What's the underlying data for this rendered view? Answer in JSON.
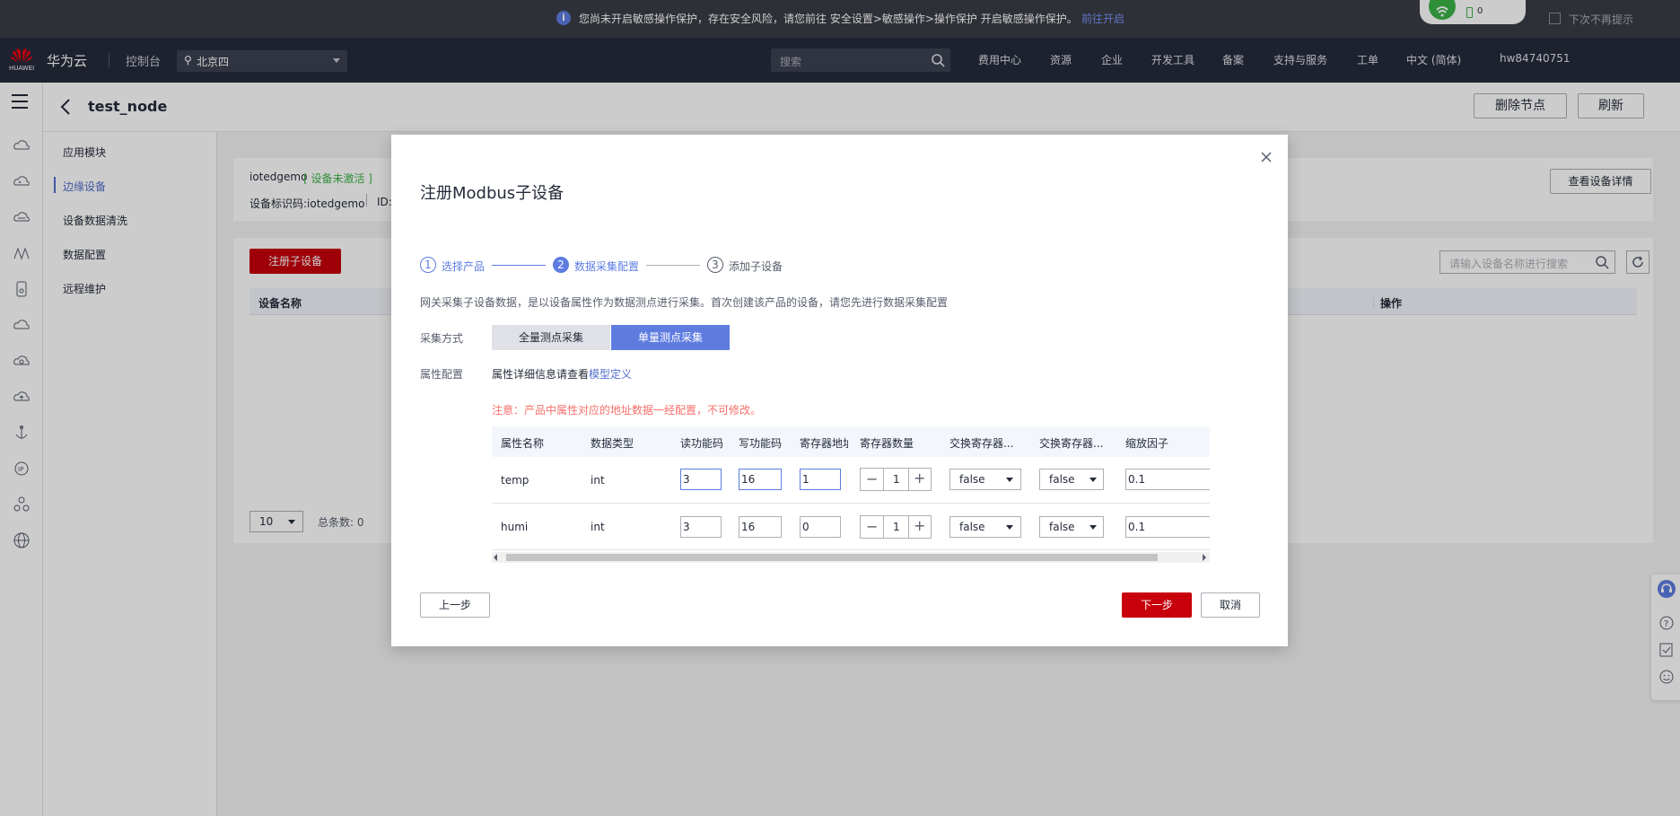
{
  "notice": {
    "message": "您尚未开启敏感操作保护，存在安全风险，请您前往 安全设置>敏感操作>操作保护 开启敏感操作保护。",
    "link": "前往开启",
    "checkbox_label": "下次不再提示",
    "widget_count": "0"
  },
  "header": {
    "logo_sub": "HUAWEI",
    "brand": "华为云",
    "console": "控制台",
    "region": "北京四",
    "search_placeholder": "搜索",
    "nav": [
      "费用中心",
      "资源",
      "企业",
      "开发工具",
      "备案",
      "支持与服务",
      "工单",
      "中文 (简体)",
      "hw84740751"
    ]
  },
  "page": {
    "title": "test_node",
    "delete_node": "删除节点",
    "refresh": "刷新"
  },
  "sidemenu": [
    "应用模块",
    "边缘设备",
    "设备数据清洗",
    "数据配置",
    "远程维护"
  ],
  "device": {
    "name": "iotedgemo",
    "status": "[ 设备未激活 ]",
    "id_line": "设备标识码:iotedgemo",
    "id_label": "ID:",
    "view_detail": "查看设备详情"
  },
  "list": {
    "register_btn": "注册子设备",
    "search_placeholder": "请输入设备名称进行搜索",
    "col_name": "设备名称",
    "col_op": "操作",
    "page_size": "10",
    "total": "总条数:  0"
  },
  "modal": {
    "title": "注册Modbus子设备",
    "steps": [
      {
        "num": "1",
        "label": "选择产品"
      },
      {
        "num": "2",
        "label": "数据采集配置"
      },
      {
        "num": "3",
        "label": "添加子设备"
      }
    ],
    "desc": "网关采集子设备数据，是以设备属性作为数据测点进行采集。首次创建该产品的设备，请您先进行数据采集配置",
    "collect_label": "采集方式",
    "tabs": [
      "全量测点采集",
      "单量测点采集"
    ],
    "attr_label": "属性配置",
    "attr_text": "属性详细信息请查看",
    "attr_link": "模型定义",
    "warning": "注意：产品中属性对应的地址数据一经配置，不可修改。",
    "columns": [
      "属性名称",
      "数据类型",
      "读功能码",
      "写功能码",
      "寄存器地址",
      "寄存器数量",
      "交换寄存器...",
      "交换寄存器...",
      "缩放因子"
    ],
    "rows": [
      {
        "name": "temp",
        "type": "int",
        "read": "3",
        "write": "16",
        "addr": "1",
        "count": "1",
        "swap1": "false",
        "swap2": "false",
        "scale": "0.1"
      },
      {
        "name": "humi",
        "type": "int",
        "read": "3",
        "write": "16",
        "addr": "0",
        "count": "1",
        "swap1": "false",
        "swap2": "false",
        "scale": "0.1"
      }
    ],
    "prev": "上一步",
    "next": "下一步",
    "cancel": "取消"
  },
  "colors": {
    "brand_red": "#c7000b",
    "primary_blue": "#5e7ce0",
    "header_bg": "#252b3a"
  }
}
